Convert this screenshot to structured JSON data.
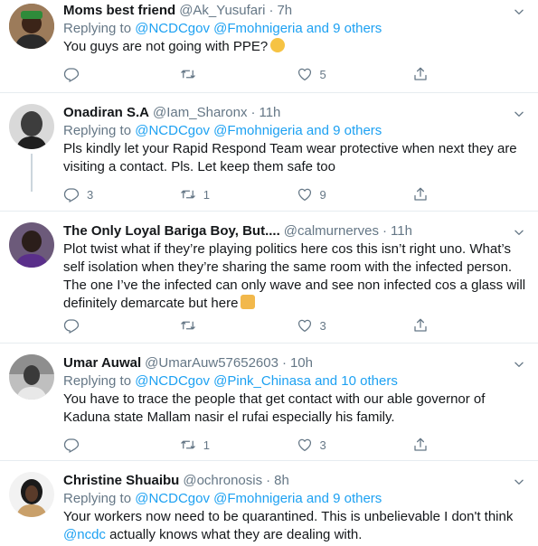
{
  "tweets": [
    {
      "name": "Moms best friend",
      "handle": "@Ak_Yusufari",
      "time": "7h",
      "reply_prefix": "Replying to",
      "mentions": "@NCDCgov @Fmohnigeria",
      "others": "and 9 others",
      "text": "You guys are not going with PPE?",
      "replies": "",
      "retweets": "",
      "likes": "5"
    },
    {
      "name": "Onadiran S.A",
      "handle": "@Iam_Sharonx",
      "time": "11h",
      "reply_prefix": "Replying to",
      "mentions": "@NCDCgov @Fmohnigeria",
      "others": "and 9 others",
      "text_lines": [
        "Pls kindly let your Rapid Respond Team  wear protective when next they are",
        "visiting a contact. Pls. Let keep them safe too"
      ],
      "replies": "3",
      "retweets": "1",
      "likes": "9"
    },
    {
      "name": "The Only Loyal Bariga Boy, But....",
      "handle": "@calmurnerves",
      "time": "11h",
      "text_lines": [
        "Plot twist what if they’re playing politics here cos this isn’t right uno. What’s",
        "self isolation when they’re sharing the same room with the infected person.",
        "The one I’ve the infected can only wave and see non infected cos a glass will",
        "definitely demarcate but here"
      ],
      "replies": "",
      "retweets": "",
      "likes": "3"
    },
    {
      "name": "Umar Auwal",
      "handle": "@UmarAuw57652603",
      "time": "10h",
      "reply_prefix": "Replying to",
      "mentions": "@NCDCgov @Pink_Chinasa",
      "others": "and 10 others",
      "text_lines": [
        "You have to trace the people that get contact with our able governor of",
        "Kaduna state Mallam nasir el rufai especially his family."
      ],
      "replies": "",
      "retweets": "1",
      "likes": "3"
    },
    {
      "name": "Christine Shuaibu",
      "handle": "@ochronosis",
      "time": "8h",
      "reply_prefix": "Replying to",
      "mentions": "@NCDCgov @Fmohnigeria",
      "others": "and 9 others",
      "text_lines": [
        "Your workers now need to be quarantined.  This is unbelievable I don't think"
      ],
      "link_start": "@ncdc",
      "text_tail": " actually knows what they are dealing with."
    }
  ],
  "separator": "·",
  "colors": {
    "link": "#1da1f2",
    "muted": "#657786",
    "text": "#14171a",
    "border": "#e6ecf0"
  },
  "icons": [
    "reply-icon",
    "retweet-icon",
    "like-icon",
    "share-icon",
    "chevron-down-icon",
    "thinking-face-emoji",
    "shrug-emoji"
  ]
}
